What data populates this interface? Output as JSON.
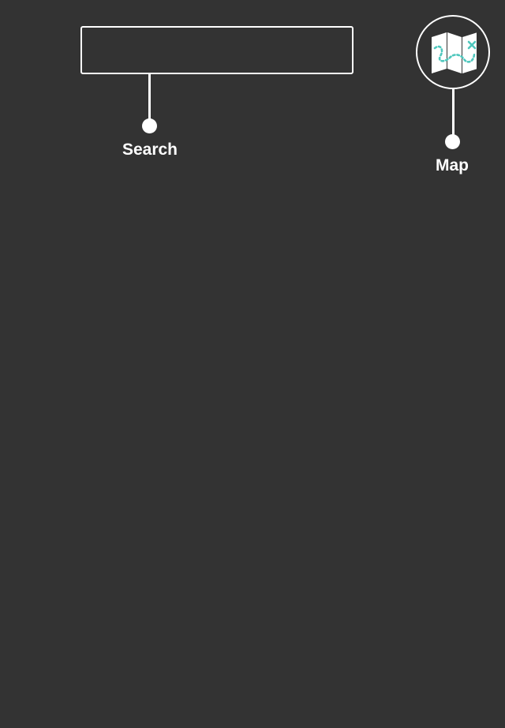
{
  "search": {
    "label": "Search",
    "value": "",
    "placeholder": ""
  },
  "map": {
    "label": "Map",
    "icon": "map-icon",
    "route_color": "#4fc7bd"
  },
  "colors": {
    "background": "#333333",
    "foreground": "#ffffff",
    "accent": "#4fc7bd"
  }
}
